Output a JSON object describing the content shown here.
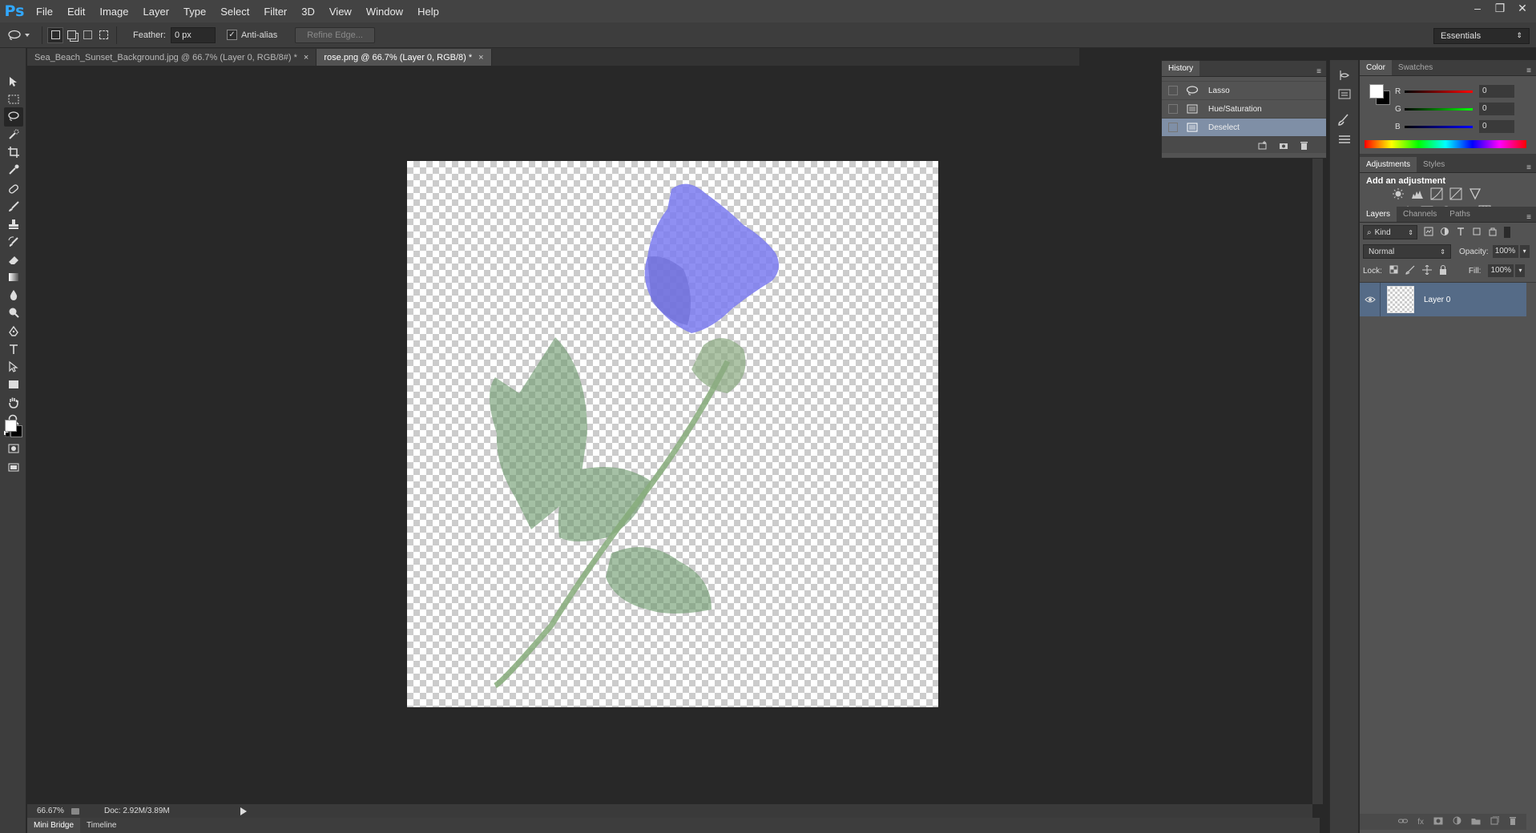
{
  "app": {
    "logo": "Ps"
  },
  "menu": [
    "File",
    "Edit",
    "Image",
    "Layer",
    "Type",
    "Select",
    "Filter",
    "3D",
    "View",
    "Window",
    "Help"
  ],
  "window_controls": {
    "minimize": "–",
    "restore": "❐",
    "close": "✕"
  },
  "options": {
    "feather_label": "Feather:",
    "feather_value": "0 px",
    "antialias_label": "Anti-alias",
    "antialias_checked": "✓",
    "refine_edge": "Refine Edge...",
    "workspace": "Essentials"
  },
  "tabs": [
    {
      "label": "Sea_Beach_Sunset_Background.jpg @ 66.7% (Layer 0, RGB/8#) *",
      "close": "×"
    },
    {
      "label": "rose.png @ 66.7% (Layer 0, RGB/8) *",
      "close": "×"
    }
  ],
  "history": {
    "tab": "History",
    "items": [
      {
        "label": "Lasso",
        "icon": "lasso-icon"
      },
      {
        "label": "Hue/Saturation",
        "icon": "document-icon"
      },
      {
        "label": "Deselect",
        "icon": "document-icon"
      }
    ]
  },
  "color": {
    "tabs": [
      "Color",
      "Swatches"
    ],
    "channels": [
      {
        "name": "R",
        "value": "0"
      },
      {
        "name": "G",
        "value": "0"
      },
      {
        "name": "B",
        "value": "0"
      }
    ],
    "foreground": "#ffffff",
    "background": "#000000"
  },
  "adjustments": {
    "tabs": [
      "Adjustments",
      "Styles"
    ],
    "heading": "Add an adjustment"
  },
  "layers": {
    "tabs": [
      "Layers",
      "Channels",
      "Paths"
    ],
    "filter_kind": "Kind",
    "blend_mode": "Normal",
    "opacity_label": "Opacity:",
    "opacity_value": "100%",
    "lock_label": "Lock:",
    "fill_label": "Fill:",
    "fill_value": "100%",
    "items": [
      {
        "name": "Layer 0"
      }
    ]
  },
  "status": {
    "zoom": "66.67%",
    "doc": "Doc: 2.92M/3.89M"
  },
  "bottom_tabs": [
    "Mini Bridge",
    "Timeline"
  ]
}
